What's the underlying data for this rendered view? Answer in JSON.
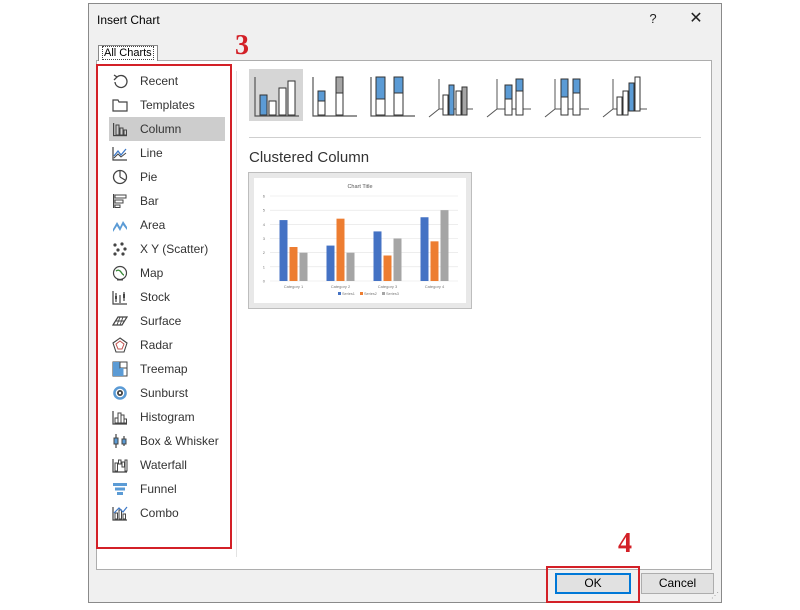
{
  "dialog": {
    "title": "Insert Chart",
    "help_label": "?",
    "close_label": "✕",
    "tab_all_charts": "All Charts",
    "ok_label": "OK",
    "cancel_label": "Cancel"
  },
  "chart_types": [
    {
      "label": "Recent",
      "icon": "recent-icon"
    },
    {
      "label": "Templates",
      "icon": "templates-icon"
    },
    {
      "label": "Column",
      "icon": "column-chart-icon",
      "selected": true
    },
    {
      "label": "Line",
      "icon": "line-chart-icon"
    },
    {
      "label": "Pie",
      "icon": "pie-chart-icon"
    },
    {
      "label": "Bar",
      "icon": "bar-chart-icon"
    },
    {
      "label": "Area",
      "icon": "area-chart-icon"
    },
    {
      "label": "X Y (Scatter)",
      "icon": "scatter-chart-icon"
    },
    {
      "label": "Map",
      "icon": "map-chart-icon"
    },
    {
      "label": "Stock",
      "icon": "stock-chart-icon"
    },
    {
      "label": "Surface",
      "icon": "surface-chart-icon"
    },
    {
      "label": "Radar",
      "icon": "radar-chart-icon"
    },
    {
      "label": "Treemap",
      "icon": "treemap-chart-icon"
    },
    {
      "label": "Sunburst",
      "icon": "sunburst-chart-icon"
    },
    {
      "label": "Histogram",
      "icon": "histogram-chart-icon"
    },
    {
      "label": "Box & Whisker",
      "icon": "box-whisker-chart-icon"
    },
    {
      "label": "Waterfall",
      "icon": "waterfall-chart-icon"
    },
    {
      "label": "Funnel",
      "icon": "funnel-chart-icon"
    },
    {
      "label": "Combo",
      "icon": "combo-chart-icon"
    }
  ],
  "subtypes": [
    {
      "icon": "clustered-column-icon",
      "selected": true
    },
    {
      "icon": "stacked-column-icon"
    },
    {
      "icon": "100-stacked-column-icon"
    },
    {
      "icon": "3d-clustered-column-icon"
    },
    {
      "icon": "3d-stacked-column-icon"
    },
    {
      "icon": "3d-100-stacked-column-icon"
    },
    {
      "icon": "3d-column-icon"
    }
  ],
  "selected_subtype_name": "Clustered Column",
  "annotations": {
    "list_number": "3",
    "ok_number": "4"
  },
  "colors": {
    "accent": "#0078d7",
    "annotation": "#d32027",
    "series1": "#4472c4",
    "series2": "#ed7d31",
    "series3": "#a5a5a5"
  },
  "chart_data": {
    "type": "bar",
    "title": "Chart Title",
    "categories": [
      "Category 1",
      "Category 2",
      "Category 3",
      "Category 4"
    ],
    "series": [
      {
        "name": "Series1",
        "values": [
          4.3,
          2.5,
          3.5,
          4.5
        ]
      },
      {
        "name": "Series2",
        "values": [
          2.4,
          4.4,
          1.8,
          2.8
        ]
      },
      {
        "name": "Series3",
        "values": [
          2,
          2,
          3,
          5
        ]
      }
    ],
    "ylim": [
      0,
      6
    ],
    "yticks": [
      0,
      1,
      2,
      3,
      4,
      5,
      6
    ],
    "grid": true,
    "legend": "bottom"
  }
}
